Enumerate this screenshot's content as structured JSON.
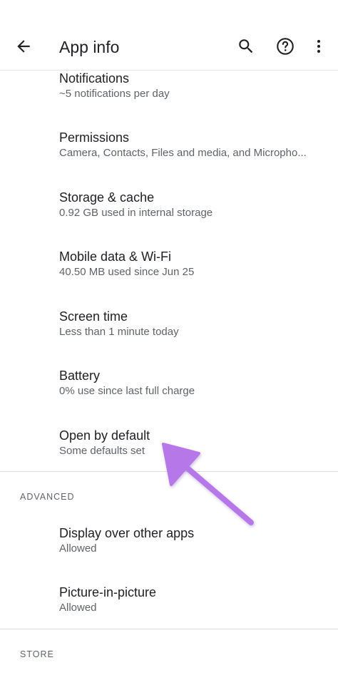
{
  "header": {
    "title": "App info",
    "icons": [
      "back-arrow-icon",
      "search-icon",
      "help-icon",
      "more-vert-icon"
    ]
  },
  "items": [
    {
      "title": "Notifications",
      "subtitle": "~5 notifications per day"
    },
    {
      "title": "Permissions",
      "subtitle": "Camera, Contacts, Files and media, and Micropho..."
    },
    {
      "title": "Storage & cache",
      "subtitle": "0.92 GB used in internal storage"
    },
    {
      "title": "Mobile data & Wi-Fi",
      "subtitle": "40.50 MB used since Jun 25"
    },
    {
      "title": "Screen time",
      "subtitle": "Less than 1 minute today"
    },
    {
      "title": "Battery",
      "subtitle": "0% use since last full charge"
    },
    {
      "title": "Open by default",
      "subtitle": "Some defaults set"
    }
  ],
  "advanced": {
    "header": "ADVANCED",
    "items": [
      {
        "title": "Display over other apps",
        "subtitle": "Allowed"
      },
      {
        "title": "Picture-in-picture",
        "subtitle": "Allowed"
      }
    ]
  },
  "store": {
    "header": "STORE"
  },
  "colors": {
    "text_primary": "#202124",
    "text_secondary": "#5f6368",
    "annotation_arrow": "#b678e8"
  }
}
